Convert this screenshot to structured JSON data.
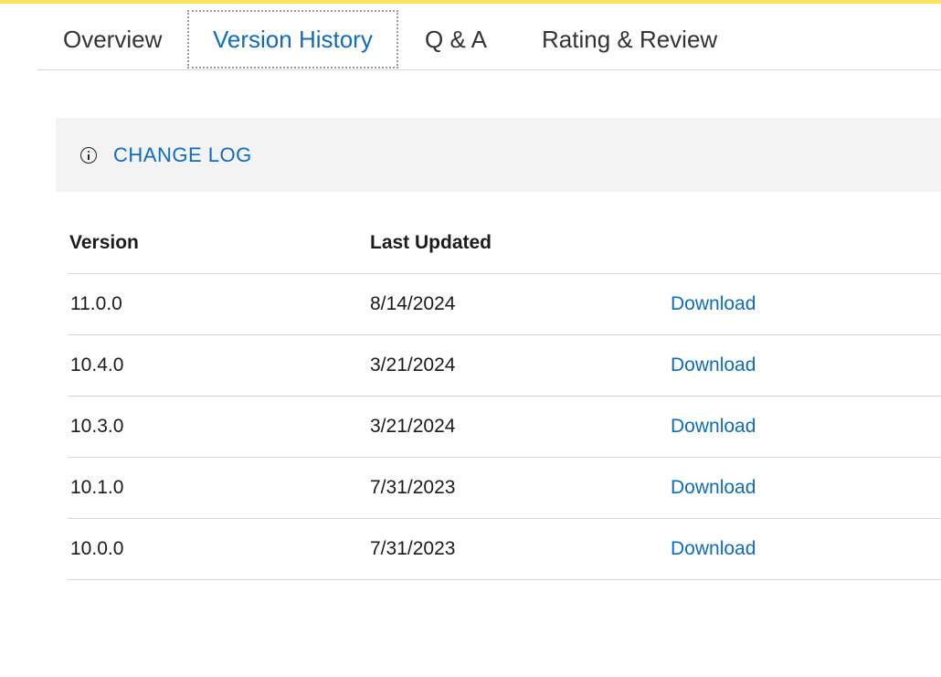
{
  "tabs": [
    {
      "label": "Overview",
      "active": false
    },
    {
      "label": "Version History",
      "active": true
    },
    {
      "label": "Q & A",
      "active": false
    },
    {
      "label": "Rating & Review",
      "active": false
    }
  ],
  "changelog": {
    "icon": "info-icon",
    "label": "CHANGE LOG"
  },
  "table": {
    "headers": {
      "version": "Version",
      "last_updated": "Last Updated"
    },
    "rows": [
      {
        "version": "11.0.0",
        "date": "8/14/2024",
        "action": "Download"
      },
      {
        "version": "10.4.0",
        "date": "3/21/2024",
        "action": "Download"
      },
      {
        "version": "10.3.0",
        "date": "3/21/2024",
        "action": "Download"
      },
      {
        "version": "10.1.0",
        "date": "7/31/2023",
        "action": "Download"
      },
      {
        "version": "10.0.0",
        "date": "7/31/2023",
        "action": "Download"
      }
    ]
  },
  "colors": {
    "accent": "#ffe45c",
    "link": "#0f6cbd",
    "panel": "#f3f3f3"
  }
}
